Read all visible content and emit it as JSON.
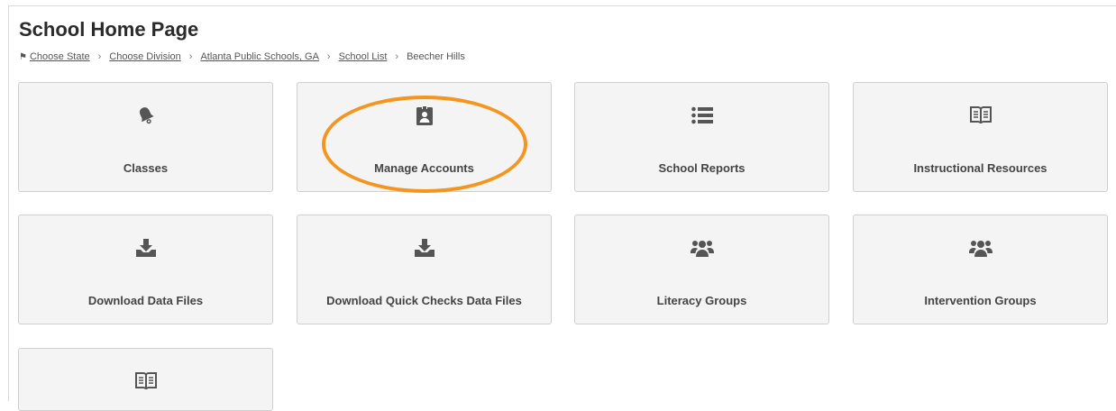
{
  "header": {
    "title": "School Home Page"
  },
  "breadcrumb": {
    "items": [
      "Choose State",
      "Choose Division",
      "Atlanta Public Schools, GA",
      "School List"
    ],
    "current": "Beecher Hills",
    "separator": "›"
  },
  "tiles": [
    {
      "label": "Classes",
      "icon": "bell-icon"
    },
    {
      "label": "Manage Accounts",
      "icon": "id-badge-icon"
    },
    {
      "label": "School Reports",
      "icon": "list-icon"
    },
    {
      "label": "Instructional Resources",
      "icon": "book-icon"
    },
    {
      "label": "Download Data Files",
      "icon": "download-icon"
    },
    {
      "label": "Download Quick Checks Data Files",
      "icon": "download-icon"
    },
    {
      "label": "Literacy Groups",
      "icon": "users-icon"
    },
    {
      "label": "Intervention Groups",
      "icon": "users-icon"
    },
    {
      "label": "",
      "icon": "book-icon"
    }
  ],
  "colors": {
    "icon": "#555555",
    "highlight": "#f3951f",
    "tile_bg": "#f4f4f4"
  }
}
